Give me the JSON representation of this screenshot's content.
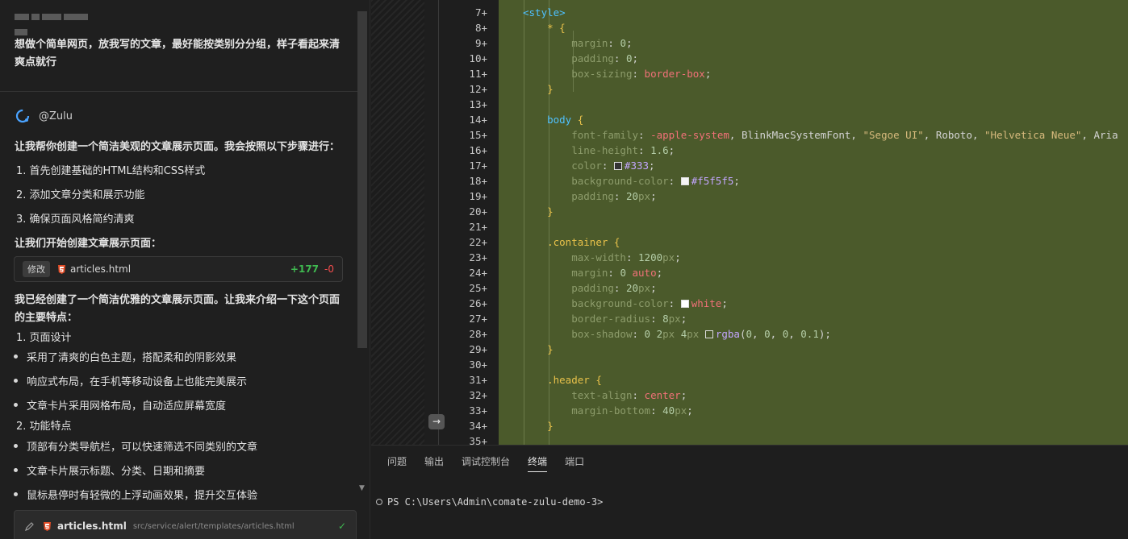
{
  "chat": {
    "user_message": "想做个简单网页，放我写的文章，最好能按类别分分组，样子看起来清爽点就行",
    "agent_name": "@Zulu",
    "intro": "让我帮你创建一个简洁美观的文章展示页面。我会按照以下步骤进行：",
    "steps": [
      "1. 首先创建基础的HTML结构和CSS样式",
      "2. 添加文章分类和展示功能",
      "3. 确保页面风格简约清爽"
    ],
    "start_text": "让我们开始创建文章展示页面：",
    "file_change": {
      "tag": "修改",
      "file": "articles.html",
      "added": "+177",
      "removed": "-0"
    },
    "summary_1": "我已经创建了一个简洁优雅的文章展示页面。让我来介绍一下这个页面",
    "summary_2": "的主要特点：",
    "section1": "1. 页面设计",
    "bullets1": [
      "采用了清爽的白色主题，搭配柔和的阴影效果",
      "响应式布局，在手机等移动设备上也能完美展示",
      "文章卡片采用网格布局，自动适应屏幕宽度"
    ],
    "section2": "2. 功能特点",
    "bullets2": [
      "顶部有分类导航栏，可以快速筛选不同类别的文章",
      "文章卡片展示标题、分类、日期和摘要",
      "鼠标悬停时有轻微的上浮动画效果，提升交互体验"
    ],
    "bottom_file": {
      "name": "articles.html",
      "path": "src/service/alert/templates/articles.html"
    }
  },
  "editor": {
    "line_numbers": [
      "7+",
      "8+",
      "9+",
      "10+",
      "11+",
      "12+",
      "13+",
      "14+",
      "15+",
      "16+",
      "17+",
      "18+",
      "19+",
      "20+",
      "21+",
      "22+",
      "23+",
      "24+",
      "25+",
      "26+",
      "27+",
      "28+",
      "29+",
      "30+",
      "31+",
      "32+",
      "33+",
      "34+",
      "35+"
    ],
    "font_family_value_a": "-apple-system",
    "font_family_value_b": ", BlinkMacSystemFont, ",
    "font_family_value_c": "\"Segoe UI\"",
    "font_family_value_d": ", Roboto, ",
    "font_family_value_e": "\"Helvetica Neue\"",
    "font_family_value_f": ", Aria",
    "colors": {
      "added_bg": "#4b5a2b",
      "selector": "#e8c14a",
      "keyword": "#f07178"
    }
  },
  "terminal": {
    "tabs": [
      "问题",
      "输出",
      "调试控制台",
      "终端",
      "端口"
    ],
    "active_tab": "终端",
    "prompt": "PS C:\\Users\\Admin\\comate-zulu-demo-3>"
  }
}
